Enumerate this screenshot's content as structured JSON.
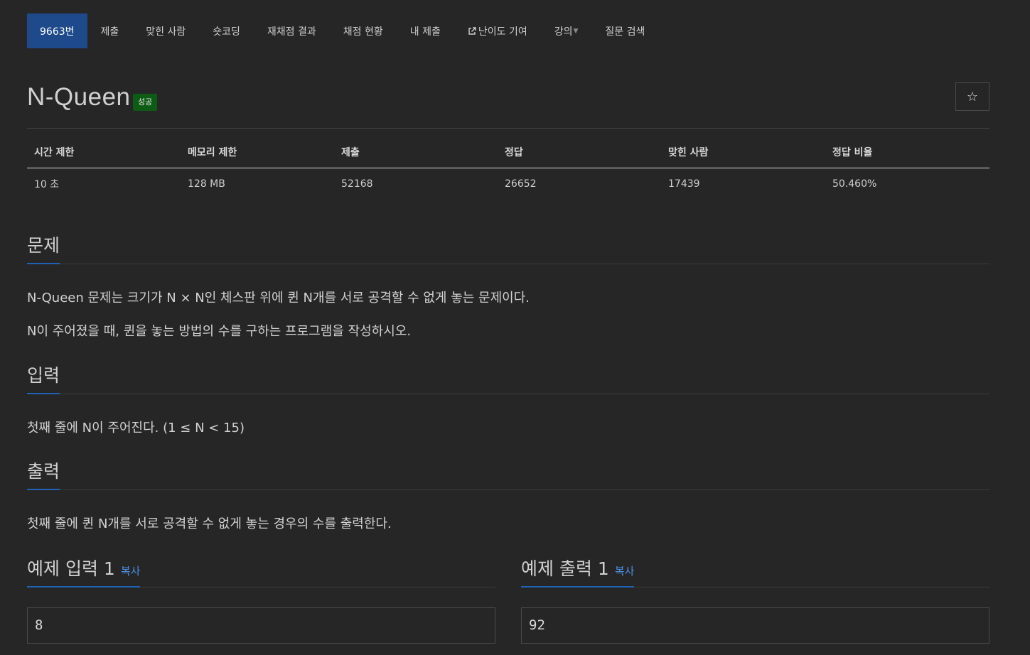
{
  "nav": {
    "items": [
      {
        "label": "9663번"
      },
      {
        "label": "제출"
      },
      {
        "label": "맞힌 사람"
      },
      {
        "label": "숏코딩"
      },
      {
        "label": "재채점 결과"
      },
      {
        "label": "채점 현황"
      },
      {
        "label": "내 제출"
      },
      {
        "label": "난이도 기여"
      },
      {
        "label": "강의"
      },
      {
        "label": "질문 검색"
      }
    ]
  },
  "problem": {
    "title": "N-Queen",
    "badge": "성공",
    "star": "☆"
  },
  "info": {
    "headers": [
      "시간 제한",
      "메모리 제한",
      "제출",
      "정답",
      "맞힌 사람",
      "정답 비율"
    ],
    "values": [
      "10 초",
      "128 MB",
      "52168",
      "26652",
      "17439",
      "50.460%"
    ]
  },
  "sections": {
    "problem_head": "문제",
    "problem_p1": "N-Queen 문제는 크기가 N × N인 체스판 위에 퀸 N개를 서로 공격할 수 없게 놓는 문제이다.",
    "problem_p2": "N이 주어졌을 때, 퀸을 놓는 방법의 수를 구하는 프로그램을 작성하시오.",
    "input_head": "입력",
    "input_p": "첫째 줄에 N이 주어진다. (1 ≤ N < 15)",
    "output_head": "출력",
    "output_p": "첫째 줄에 퀸 N개를 서로 공격할 수 없게 놓는 경우의 수를 출력한다."
  },
  "samples": {
    "input_head": "예제 입력 1",
    "output_head": "예제 출력 1",
    "copy_label": "복사",
    "input_value": "8",
    "output_value": "92"
  }
}
